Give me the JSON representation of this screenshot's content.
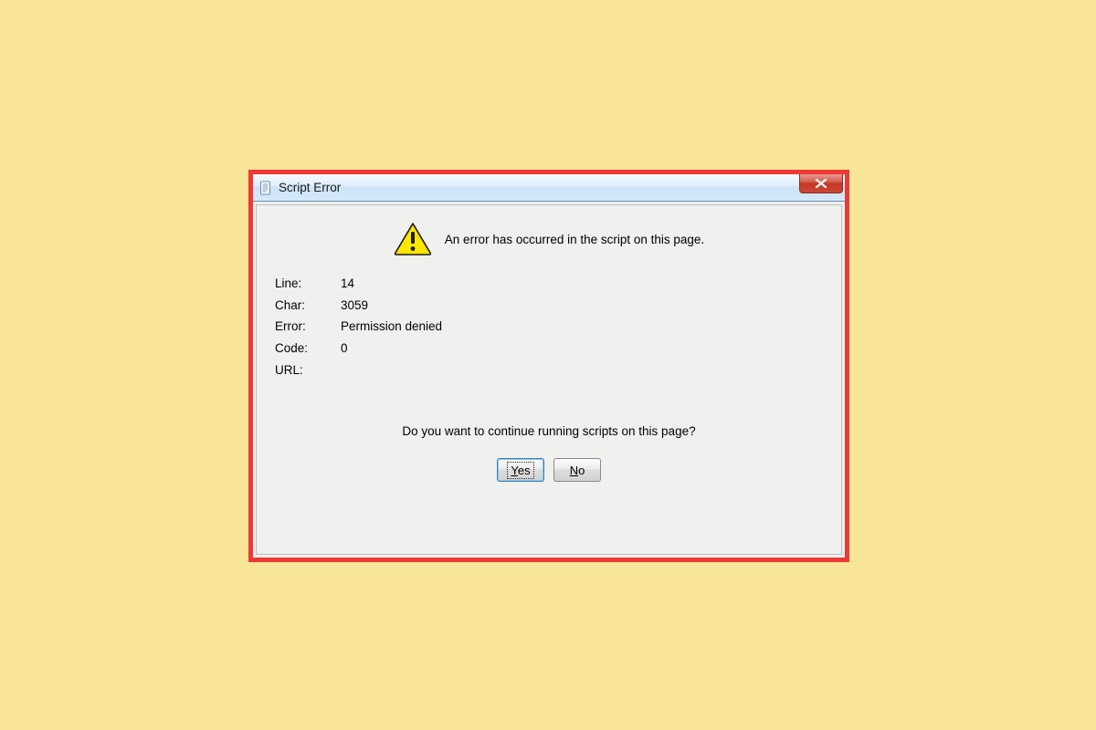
{
  "dialog": {
    "title": "Script Error",
    "message": "An error has occurred in the script on this page.",
    "details": {
      "line_label": "Line:",
      "line_value": "14",
      "char_label": "Char:",
      "char_value": "3059",
      "error_label": "Error:",
      "error_value": "Permission denied",
      "code_label": "Code:",
      "code_value": "0",
      "url_label": "URL:",
      "url_value": ""
    },
    "prompt": "Do you want to continue running scripts on this page?",
    "buttons": {
      "yes": "Yes",
      "no": "No"
    }
  },
  "colors": {
    "page_bg": "#f8e598",
    "frame_border": "#ee3936"
  }
}
